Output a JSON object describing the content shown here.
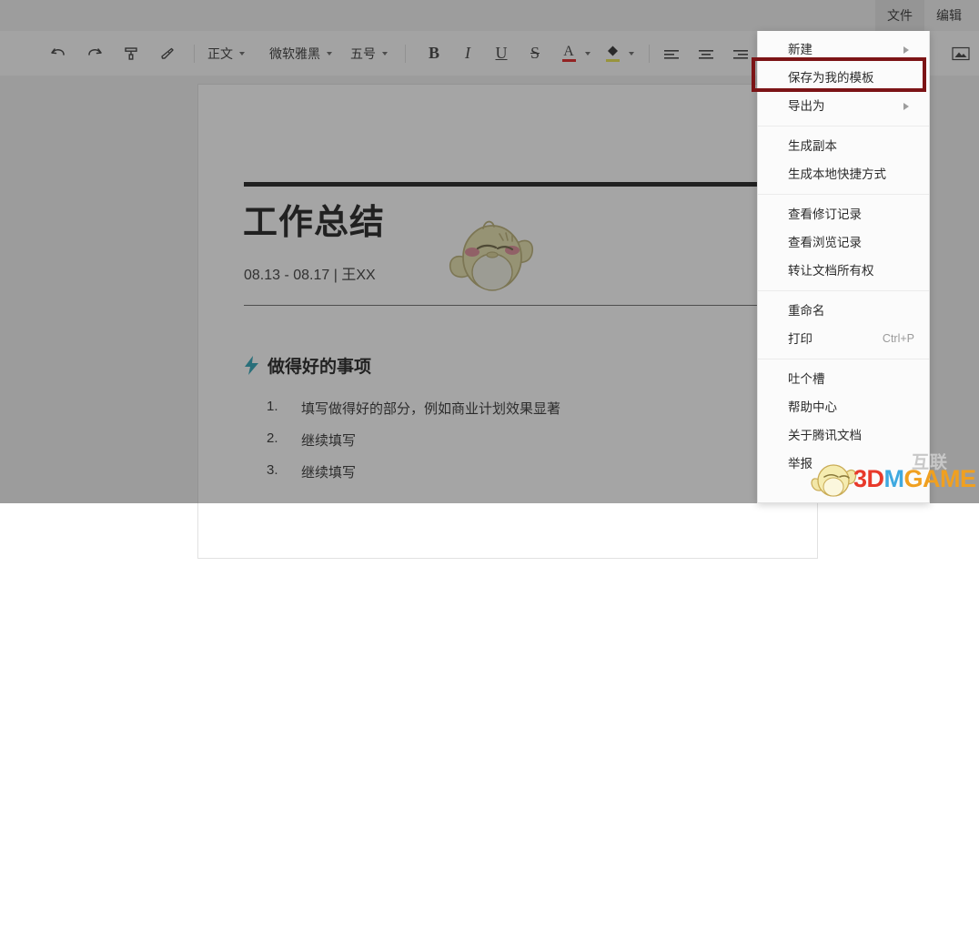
{
  "menubar": {
    "items": [
      {
        "label": "文件",
        "active": true
      },
      {
        "label": "编辑",
        "active": false
      }
    ]
  },
  "toolbar": {
    "undo_icon": "undo-arrow-icon",
    "redo_icon": "redo-arrow-icon",
    "format_painter_icon": "format-painter-icon",
    "clear_format_icon": "eraser-icon",
    "style_value": "正文",
    "font_value": "微软雅黑",
    "font_size_value": "五号",
    "bold_label": "B",
    "italic_label": "I",
    "underline_label": "U",
    "strikethrough_label": "S",
    "font_color_label": "A",
    "highlight_icon": "paint-bucket-icon",
    "align_left_icon": "align-left-icon",
    "align_center_icon": "align-center-icon",
    "align_right_icon": "align-right-icon",
    "insert_image_icon": "insert-image-icon"
  },
  "file_menu": {
    "groups": [
      [
        {
          "label": "新建",
          "submenu": true,
          "shortcut": ""
        },
        {
          "label": "保存为我的模板",
          "submenu": false,
          "shortcut": "",
          "highlighted": true
        },
        {
          "label": "导出为",
          "submenu": true,
          "shortcut": ""
        }
      ],
      [
        {
          "label": "生成副本",
          "submenu": false,
          "shortcut": ""
        },
        {
          "label": "生成本地快捷方式",
          "submenu": false,
          "shortcut": ""
        }
      ],
      [
        {
          "label": "查看修订记录",
          "submenu": false,
          "shortcut": ""
        },
        {
          "label": "查看浏览记录",
          "submenu": false,
          "shortcut": ""
        },
        {
          "label": "转让文档所有权",
          "submenu": false,
          "shortcut": ""
        }
      ],
      [
        {
          "label": "重命名",
          "submenu": false,
          "shortcut": ""
        },
        {
          "label": "打印",
          "submenu": false,
          "shortcut": "Ctrl+P"
        }
      ],
      [
        {
          "label": "吐个槽",
          "submenu": false,
          "shortcut": ""
        },
        {
          "label": "帮助中心",
          "submenu": false,
          "shortcut": ""
        },
        {
          "label": "关于腾讯文档",
          "submenu": false,
          "shortcut": ""
        },
        {
          "label": "举报",
          "submenu": false,
          "shortcut": ""
        }
      ]
    ]
  },
  "document": {
    "title": "工作总结",
    "subtitle": "08.13 - 08.17 | 王XX",
    "section_icon": "lightning-bolt-icon",
    "section_title": "做得好的事项",
    "list": [
      {
        "num": "1.",
        "text": "填写做得好的部分，例如商业计划效果显著"
      },
      {
        "num": "2.",
        "text": "继续填写"
      },
      {
        "num": "3.",
        "text": "继续填写"
      }
    ],
    "mascot_icon": "chick-mascot-illustration"
  },
  "watermark": {
    "text_3d": "3D",
    "text_m": "M",
    "text_game": "GAME",
    "chinese": "互联",
    "chick_icon": "chick-watermark-icon"
  },
  "colors": {
    "highlight_border": "#7c1416",
    "menu_bg": "#fbfbfb",
    "accent_teal": "#2aa3b5",
    "font_color_underline": "#e02020",
    "highlight_yellow": "#e8e24a",
    "wm_red": "#e8392a",
    "wm_blue": "#3fa9e0",
    "wm_orange": "#f0a020"
  }
}
